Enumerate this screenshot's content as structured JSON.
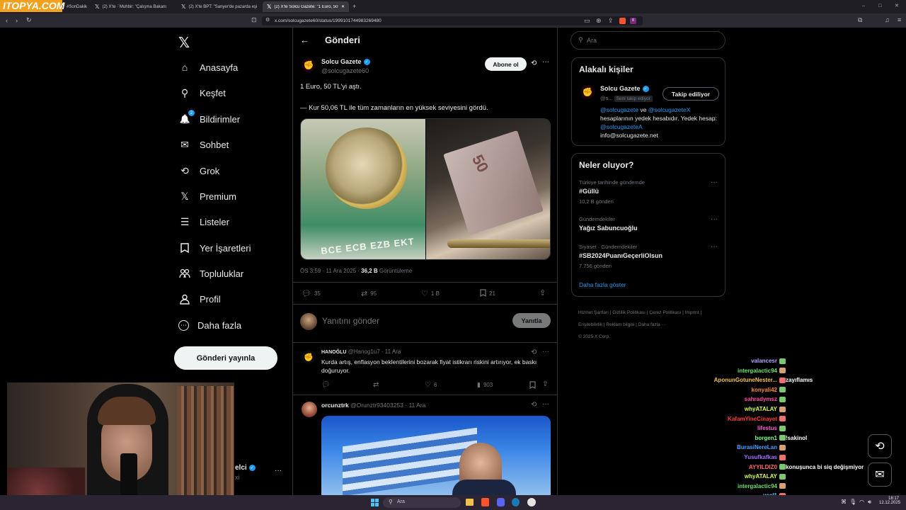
{
  "browser": {
    "brand_logo": "ITOPYA.COM",
    "tabs": [
      {
        "label": "#SonDakik"
      },
      {
        "label": "(2) X'te ·̈ Muhbir: \"Çalışma Bakanı"
      },
      {
        "label": "(2) X'te BPT: \"Sanyer'de pazarda eşi"
      },
      {
        "label": "(2) X'te Solcu Gazete: \"1 Euro, 50"
      }
    ],
    "new_tab": "+",
    "url": "x.com/solcugazete60/status/1999101744983269480",
    "notification_count": "8",
    "window_controls": [
      "–",
      "□",
      "✕"
    ]
  },
  "nav": {
    "logo": "𝕏",
    "items": [
      {
        "label": "Anasayfa",
        "icon": "home-icon",
        "glyph": "⌂"
      },
      {
        "label": "Keşfet",
        "icon": "search-icon",
        "glyph": "⚲"
      },
      {
        "label": "Bildirimler",
        "icon": "bell-icon",
        "glyph": "🔔",
        "badge": "2"
      },
      {
        "label": "Sohbet",
        "icon": "mail-icon",
        "glyph": "✉"
      },
      {
        "label": "Grok",
        "icon": "grok-icon",
        "glyph": "⟲"
      },
      {
        "label": "Premium",
        "icon": "x-premium-icon",
        "glyph": "𝕏"
      },
      {
        "label": "Listeler",
        "icon": "list-icon",
        "glyph": "☰"
      },
      {
        "label": "Yer İşaretleri",
        "icon": "bookmark-icon",
        "glyph": "🔖"
      },
      {
        "label": "Topluluklar",
        "icon": "communities-icon",
        "glyph": "👥"
      },
      {
        "label": "Profil",
        "icon": "profile-icon",
        "glyph": "👤"
      },
      {
        "label": "Daha fazla",
        "icon": "more-circle-icon",
        "glyph": "⋯"
      }
    ],
    "post_button": "Gönderi yayınla",
    "account_name_fragment": "elci",
    "account_handle_fragment": "xi",
    "account_more": "···"
  },
  "main": {
    "header_title": "Gönderi",
    "back_glyph": "←",
    "post": {
      "name": "Solcu Gazete",
      "handle": "@solcugazete60",
      "subscribe": "Abone ol",
      "text_line1": "1 Euro, 50 TL'yi aştı.",
      "text_line2": "— Kur 50,06 TL ile tüm zamanların en yüksek seviyesini gördü.",
      "timestamp": "ÖS 3:59 · 11 Ara 2025 · ",
      "views": "36,2 B",
      "views_label": " Görüntüleme",
      "replies": "35",
      "reposts": "95",
      "likes": "1 B",
      "bookmarks": "21",
      "image_coin_text": "BCE ECB EZB EKT",
      "image_banknote_text": "50"
    },
    "reply_placeholder": "Yanıtını gönder",
    "reply_button": "Yanıtla",
    "replies": [
      {
        "name": "HANOĞLU",
        "handle": "@Hanog1u7",
        "date": " · 11 Ara",
        "text": "Kurda artış, enflasyon beklentilerini bozarak fiyat istikrarı riskini artırıyor, ek baskı doğuruyor.",
        "likes": "6",
        "views": "903"
      },
      {
        "name": "orcunztrk",
        "handle": "@Orunztr93403253",
        "date": " · 11 Ara"
      }
    ]
  },
  "right": {
    "search_placeholder": "Ara",
    "related_title": "Alakalı kişiler",
    "related": {
      "name": "Solcu Gazete",
      "handle": "@s...",
      "follows_you": "Seni takip ediyor",
      "follow_button": "Takip ediliyor",
      "bio_link1": "@solcugazete",
      "bio_and": " ve ",
      "bio_link2": "@solcugazeteX",
      "bio_text": " hesaplarının yedek hesabıdır. Yedek hesap: ",
      "bio_link3": "@solcugazeteA",
      "bio_email": "info@solcugazete.net"
    },
    "trends_title": "Neler oluyor?",
    "trends": [
      {
        "category": "Türkiye tarihinde gündemde",
        "name": "#Güllü",
        "count": "10,2 B gönderi"
      },
      {
        "category": "Gündemdekiler",
        "name": "Yağız Sabuncuoğlu",
        "count": ""
      },
      {
        "category": "Siyaset · Gündemdekiler",
        "name": "#SB2024PuanıGeçerliOlsun",
        "count": "7.756 gönderi"
      }
    ],
    "show_more": "Daha fazla göster",
    "footer": [
      "Hizmet Şartları",
      "Gizlilik Politikası",
      "Çerez Politikası",
      "Imprint",
      "Erişilebilirlik",
      "Reklam bilgisi",
      "Daha fazla ···"
    ],
    "copyright": "© 2025 X Corp."
  },
  "chat": [
    {
      "user": "valancesr",
      "color": "#b9a3ff",
      "msg": ""
    },
    {
      "user": "intergalactic94",
      "color": "#6fe06f",
      "msg": ""
    },
    {
      "user": "AponunGotuneNester...",
      "color": "#f5c24b",
      "msg": "zayıflamıs"
    },
    {
      "user": "konyali42",
      "color": "#ff8a3c",
      "msg": ""
    },
    {
      "user": "sahradymsz",
      "color": "#ff4fa0",
      "msg": ""
    },
    {
      "user": "whyATALAY",
      "color": "#d6ff4f",
      "msg": ""
    },
    {
      "user": "KafamYineCinayet",
      "color": "#ff3b3b",
      "msg": ""
    },
    {
      "user": "lifestus",
      "color": "#ff5fd1",
      "msg": ""
    },
    {
      "user": "borgen1",
      "color": "#7dff8a",
      "msg": "!sakinol"
    },
    {
      "user": "BurasiNereLan",
      "color": "#4fa0ff",
      "msg": ""
    },
    {
      "user": "Yusufkafkas",
      "color": "#a070ff",
      "msg": ""
    },
    {
      "user": "AYYILDIZ0",
      "color": "#ff6b6b",
      "msg": "konuşunca bi siq değişmiyor"
    },
    {
      "user": "whyATALAY",
      "color": "#d6ff4f",
      "msg": ""
    },
    {
      "user": "intergalactic94",
      "color": "#6fe06f",
      "msg": ""
    },
    {
      "user": "yeel1",
      "color": "#4fd0ff",
      "msg": ""
    }
  ],
  "taskbar": {
    "search_placeholder": "Ara",
    "time": "18:17",
    "date": "12.12.2025"
  }
}
